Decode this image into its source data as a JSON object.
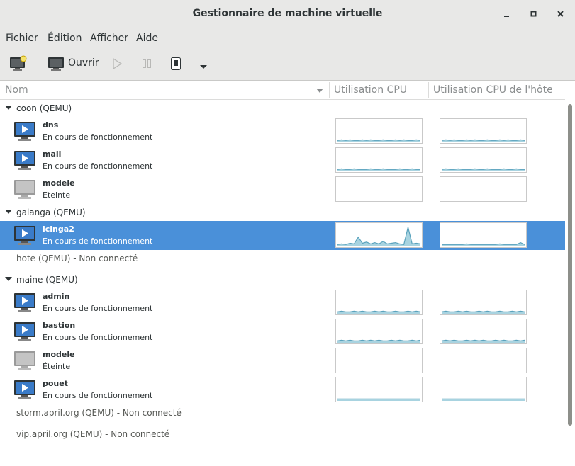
{
  "window": {
    "title": "Gestionnaire de machine virtuelle"
  },
  "menu": [
    "Fichier",
    "Édition",
    "Afficher",
    "Aide"
  ],
  "toolbar": {
    "open_label": "Ouvrir"
  },
  "columns": {
    "name": "Nom",
    "cpu": "Utilisation CPU",
    "host_cpu": "Utilisation CPU de l'hôte"
  },
  "rows": [
    {
      "kind": "group",
      "label": "coon (QEMU)"
    },
    {
      "kind": "vm",
      "name": "dns",
      "status": "En cours de fonctionnement",
      "running": true,
      "selected": false,
      "cpu": [
        2,
        3,
        2,
        3,
        2,
        2,
        3,
        2,
        3,
        2,
        2,
        3,
        2,
        2,
        3,
        2,
        3,
        2,
        2,
        3,
        2
      ],
      "host": [
        2,
        3,
        2,
        3,
        2,
        2,
        3,
        2,
        3,
        2,
        2,
        3,
        2,
        2,
        3,
        2,
        3,
        2,
        2,
        3,
        2
      ]
    },
    {
      "kind": "vm",
      "name": "mail",
      "status": "En cours de fonctionnement",
      "running": true,
      "selected": false,
      "cpu": [
        2,
        3,
        2,
        2,
        3,
        2,
        2,
        2,
        3,
        2,
        2,
        3,
        2,
        2,
        2,
        3,
        2,
        2,
        3,
        2,
        2
      ],
      "host": [
        2,
        3,
        2,
        2,
        3,
        2,
        2,
        2,
        3,
        2,
        2,
        3,
        2,
        2,
        2,
        3,
        2,
        2,
        3,
        2,
        2
      ]
    },
    {
      "kind": "vm",
      "name": "modele",
      "status": "Éteinte",
      "running": false,
      "selected": false,
      "cpu": [],
      "host": []
    },
    {
      "kind": "group",
      "label": "galanga (QEMU)"
    },
    {
      "kind": "vm",
      "name": "icinga2",
      "status": "En cours de fonctionnement",
      "running": true,
      "selected": true,
      "cpu": [
        2,
        3,
        2,
        4,
        3,
        14,
        4,
        6,
        3,
        5,
        3,
        7,
        3,
        4,
        5,
        3,
        2,
        30,
        3,
        4,
        3
      ],
      "host": [
        2,
        2,
        2,
        2,
        2,
        2,
        3,
        2,
        2,
        2,
        2,
        2,
        2,
        2,
        3,
        2,
        2,
        2,
        2,
        5,
        2
      ]
    },
    {
      "kind": "disc",
      "label": "hote (QEMU) - Non connecté"
    },
    {
      "kind": "group",
      "label": "maine (QEMU)"
    },
    {
      "kind": "vm",
      "name": "admin",
      "status": "En cours de fonctionnement",
      "running": true,
      "selected": false,
      "cpu": [
        2,
        3,
        2,
        2,
        3,
        2,
        3,
        2,
        2,
        3,
        2,
        3,
        2,
        2,
        3,
        2,
        2,
        3,
        2,
        3,
        2
      ],
      "host": [
        2,
        3,
        2,
        2,
        3,
        2,
        3,
        2,
        2,
        3,
        2,
        3,
        2,
        2,
        3,
        2,
        2,
        3,
        2,
        3,
        2
      ]
    },
    {
      "kind": "vm",
      "name": "bastion",
      "status": "En cours de fonctionnement",
      "running": true,
      "selected": false,
      "cpu": [
        2,
        3,
        2,
        3,
        2,
        2,
        3,
        2,
        3,
        2,
        3,
        2,
        2,
        3,
        2,
        3,
        2,
        2,
        3,
        2,
        3
      ],
      "host": [
        2,
        3,
        2,
        3,
        2,
        2,
        3,
        2,
        3,
        2,
        3,
        2,
        2,
        3,
        2,
        3,
        2,
        2,
        3,
        2,
        3
      ]
    },
    {
      "kind": "vm",
      "name": "modele",
      "status": "Éteinte",
      "running": false,
      "selected": false,
      "cpu": [],
      "host": []
    },
    {
      "kind": "vm",
      "name": "pouet",
      "status": "En cours de fonctionnement",
      "running": true,
      "selected": false,
      "cpu": [
        2,
        2,
        2,
        2,
        2,
        2,
        2,
        2,
        2,
        2,
        2,
        2,
        2,
        2,
        2,
        2,
        2,
        2,
        2,
        2,
        2
      ],
      "host": [
        2,
        2,
        2,
        2,
        2,
        2,
        2,
        2,
        2,
        2,
        2,
        2,
        2,
        2,
        2,
        2,
        2,
        2,
        2,
        2,
        2
      ]
    },
    {
      "kind": "disc",
      "label": "storm.april.org (QEMU) - Non connecté"
    },
    {
      "kind": "disc",
      "label": "vip.april.org (QEMU) - Non connecté"
    }
  ]
}
